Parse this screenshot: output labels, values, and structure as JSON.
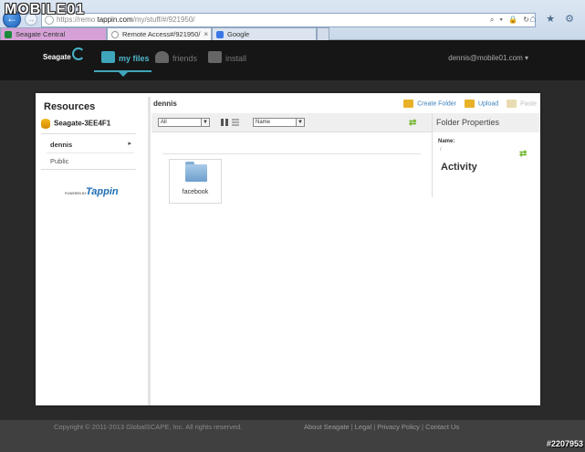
{
  "browser": {
    "address": {
      "prefix": "https://remo",
      "host": "tappin.com",
      "path": "/my/stuff/#/921950/",
      "tools": "⌕ ▾ 🔒 ↻"
    },
    "chrome_icons": "⌂ ★ ⚙",
    "tabs": [
      {
        "label": "Seagate Central",
        "favicon_color": "#1a8a3a",
        "active": false
      },
      {
        "label": "Remote Access#/921950/",
        "favicon_color": "#9a9a9a",
        "active": true
      },
      {
        "label": "Google",
        "favicon_color": "#3b78e7",
        "active": false
      }
    ],
    "close_glyph": "×"
  },
  "watermark_logo": "MOBILE01",
  "app": {
    "brand": "Seagate",
    "nav": [
      {
        "label": "my files",
        "active": true
      },
      {
        "label": "friends",
        "active": false
      },
      {
        "label": "install",
        "active": false
      }
    ],
    "user": "dennis@mobile01.com ▾"
  },
  "resources": {
    "title": "Resources",
    "device": "Seagate-3EE4F1",
    "tree": [
      {
        "label": "dennis",
        "selected": true
      },
      {
        "label": "Public",
        "selected": false
      }
    ],
    "powered_by": "POWERED BY",
    "tappin": "Tappin"
  },
  "browser_pane": {
    "location": "dennis",
    "actions": [
      {
        "label": "Create Folder",
        "enabled": true
      },
      {
        "label": "Upload",
        "enabled": true
      },
      {
        "label": "Paste",
        "enabled": false
      }
    ],
    "filter": "All",
    "sort": "Name",
    "refresh_icon": "⇄",
    "items": [
      {
        "name": "facebook",
        "type": "folder"
      }
    ]
  },
  "properties": {
    "title": "Folder Properties",
    "name_label": "Name:",
    "name_value": "/",
    "refresh_icon": "⇄",
    "activity_title": "Activity"
  },
  "footer": {
    "copyright": "Copyright © 2011-2013 GlobalSCAPE, Inc. All rights reserved.",
    "links": [
      "About Seagate",
      "Legal",
      "Privacy Policy",
      "Contact Us"
    ],
    "watermark": "#2207953"
  }
}
